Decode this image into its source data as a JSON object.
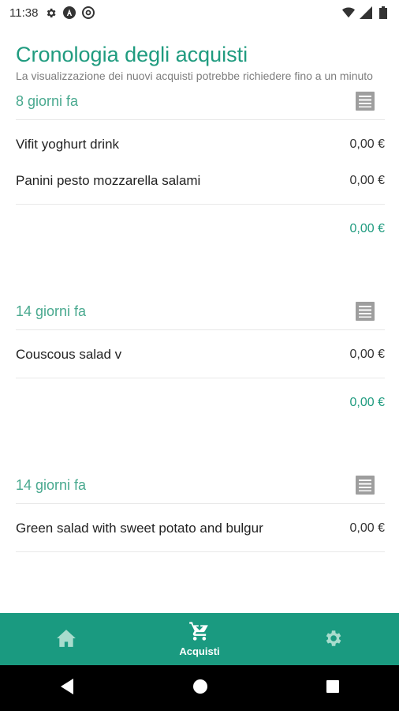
{
  "status_bar": {
    "time": "11:38",
    "icons_left": [
      "gear-icon",
      "a-circle-icon",
      "at-circle-icon"
    ],
    "icons_right": [
      "wifi-icon",
      "signal-icon",
      "battery-icon"
    ]
  },
  "header": {
    "title": "Cronologia degli acquisti",
    "subtitle": "La visualizzazione dei nuovi acquisti potrebbe richiedere fino a un minuto"
  },
  "groups": [
    {
      "date": "8 giorni fa",
      "items": [
        {
          "name": "Vifit yoghurt drink",
          "price": "0,00 €"
        },
        {
          "name": "Panini pesto mozzarella salami",
          "price": "0,00 €"
        }
      ],
      "total": "0,00 €"
    },
    {
      "date": "14 giorni fa",
      "items": [
        {
          "name": "Couscous salad v",
          "price": "0,00 €"
        }
      ],
      "total": "0,00 €"
    },
    {
      "date": "14 giorni fa",
      "items": [
        {
          "name": "Green salad with sweet potato and bulgur",
          "price": "0,00 €"
        }
      ],
      "total": ""
    }
  ],
  "bottom_nav": {
    "items": [
      {
        "icon": "home-icon",
        "label": ""
      },
      {
        "icon": "cart-icon",
        "label": "Acquisti",
        "active": true
      },
      {
        "icon": "gear-icon",
        "label": ""
      }
    ]
  },
  "system_nav": [
    "back-icon",
    "home-circle-icon",
    "recents-icon"
  ],
  "colors": {
    "accent": "#1f9b7f",
    "nav_bar": "#1a9a80"
  }
}
